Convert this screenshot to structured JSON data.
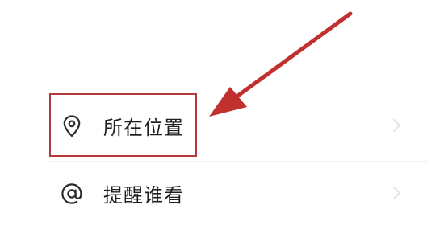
{
  "menu": {
    "items": [
      {
        "label": "所在位置",
        "icon": "location-pin-icon"
      },
      {
        "label": "提醒谁看",
        "icon": "at-sign-icon"
      }
    ]
  },
  "annotation": {
    "highlight_color": "#b23a3a",
    "arrow_color": "#c0302f",
    "target": "所在位置"
  },
  "colors": {
    "text": "#1f1f1f",
    "chevron": "#e6e6e6",
    "divider": "#f0f0f0",
    "background": "#ffffff"
  }
}
